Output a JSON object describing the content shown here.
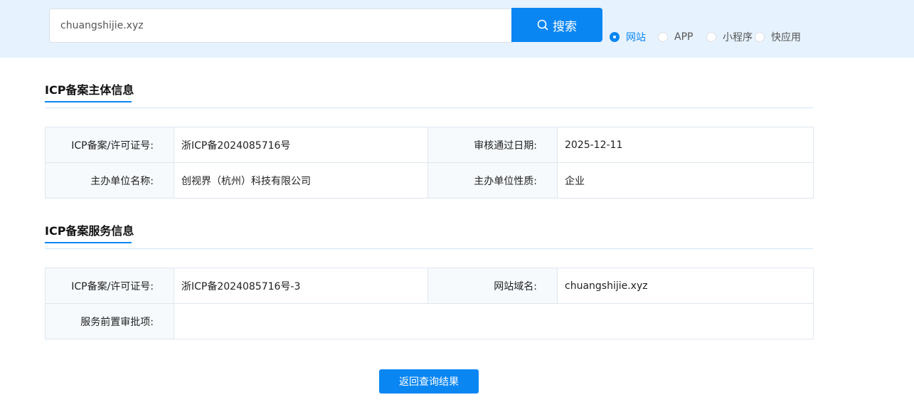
{
  "search": {
    "value": "chuangshijie.xyz",
    "button_label": "搜索",
    "options": [
      {
        "label": "网站",
        "checked": true
      },
      {
        "label": "APP",
        "checked": false
      },
      {
        "label": "小程序",
        "checked": false
      },
      {
        "label": "快应用",
        "checked": false
      }
    ]
  },
  "subject_info": {
    "title": "ICP备案主体信息",
    "rows": [
      {
        "label1": "ICP备案/许可证号:",
        "value1": "浙ICP备2024085716号",
        "label2": "审核通过日期:",
        "value2": "2025-12-11"
      },
      {
        "label1": "主办单位名称:",
        "value1": "创视界（杭州）科技有限公司",
        "label2": "主办单位性质:",
        "value2": "企业"
      }
    ]
  },
  "service_info": {
    "title": "ICP备案服务信息",
    "rows": [
      {
        "label1": "ICP备案/许可证号:",
        "value1": "浙ICP备2024085716号-3",
        "label2": "网站域名:",
        "value2": "chuangshijie.xyz"
      },
      {
        "label1": "服务前置审批项:",
        "value1": ""
      }
    ]
  },
  "back_button_label": "返回查询结果",
  "colors": {
    "accent": "#0a86f3",
    "band": "#e6f2fd",
    "label_bg": "#f6fafd"
  }
}
